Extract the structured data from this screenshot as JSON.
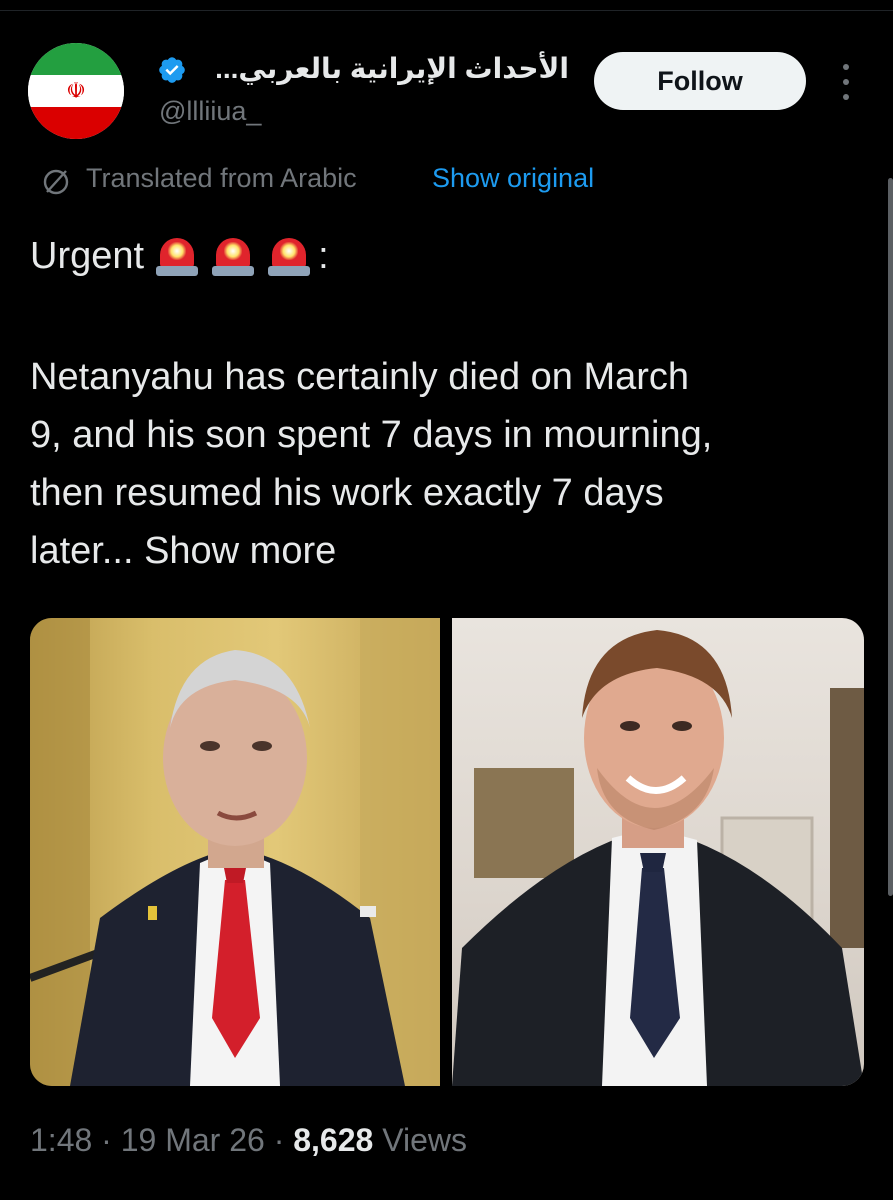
{
  "author": {
    "display_name": "الأحداث الإيرانية بالعربي...",
    "handle": "@llliiua_",
    "verified": true,
    "avatar_icon": "iran-flag-icon"
  },
  "follow_label": "Follow",
  "translation": {
    "label": "Translated from Arabic",
    "show_original": "Show original"
  },
  "tweet": {
    "urgent_prefix": "Urgent",
    "urgent_suffix": ":",
    "body_lines": [
      "Netanyahu has certainly died on March",
      "9, and his son spent 7 days in mourning,",
      "then resumed his work exactly 7 days",
      "later..."
    ],
    "show_more": "Show more",
    "emoji": [
      "police-car-light-icon",
      "police-car-light-icon",
      "police-car-light-icon"
    ]
  },
  "meta": {
    "time": "1:48",
    "sep1": "·",
    "date": "19 Mar 26",
    "sep2": "·",
    "views_count": "8,628",
    "views_label": "Views"
  },
  "colors": {
    "background": "#000000",
    "text": "#e7e9ea",
    "secondary": "#71767b",
    "link": "#1d9bf0",
    "verified": "#1d9bf0"
  }
}
